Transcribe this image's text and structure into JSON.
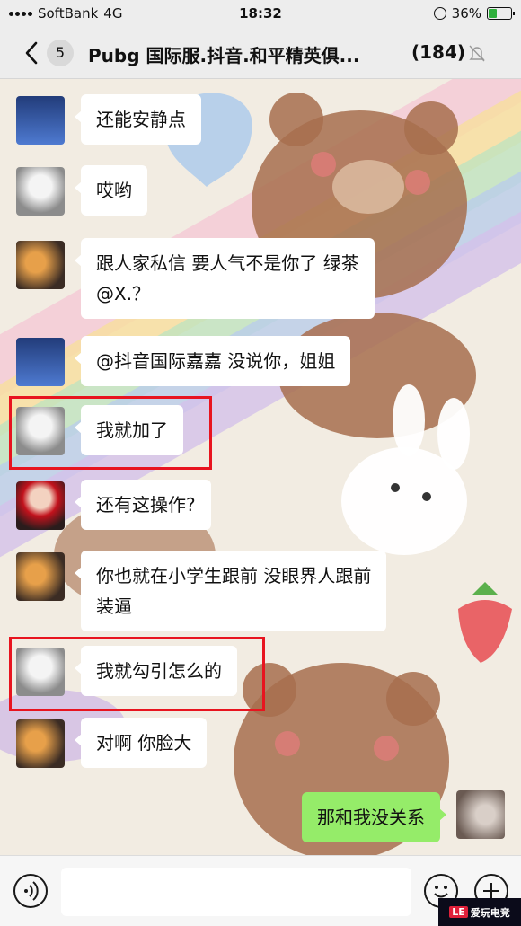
{
  "status_bar": {
    "carrier": "SoftBank",
    "network": "4G",
    "time": "18:32",
    "battery": "36%",
    "battery_level": 0.36
  },
  "header": {
    "unread_count": "5",
    "title": "Pubg 国际服.抖音.和平精英俱...",
    "member_count": "(184)"
  },
  "messages": [
    {
      "sender": "other",
      "avatar": "avatar-game-character",
      "text": "还能安静点"
    },
    {
      "sender": "other",
      "avatar": "avatar-anime-girl",
      "text": "哎哟"
    },
    {
      "sender": "other",
      "avatar": "avatar-photo",
      "text_line1": "跟人家私信 要人气不是你了 绿茶",
      "text_line2": "@X.？"
    },
    {
      "sender": "other",
      "avatar": "avatar-game-character",
      "text": "@抖音国际嘉嘉 没说你，姐姐"
    },
    {
      "sender": "other",
      "avatar": "avatar-anime-girl",
      "text": "我就加了",
      "highlighted": true
    },
    {
      "sender": "other",
      "avatar": "avatar-red-hat-girl",
      "text": "还有这操作?"
    },
    {
      "sender": "other",
      "avatar": "avatar-photo",
      "text_line1": "你也就在小学生跟前 没眼界人跟前",
      "text_line2": "装逼"
    },
    {
      "sender": "other",
      "avatar": "avatar-anime-girl",
      "text": "我就勾引怎么的",
      "highlighted": true
    },
    {
      "sender": "other",
      "avatar": "avatar-photo",
      "text": "对啊 你脸大"
    },
    {
      "sender": "me",
      "avatar": "avatar-self",
      "text": "那和我没关系"
    }
  ],
  "input_bar": {
    "placeholder": ""
  },
  "watermark": {
    "badge": "LE",
    "text": "爱玩电竞"
  },
  "colors": {
    "highlight": "#e8141f",
    "my_bubble": "#95ec69",
    "other_bubble": "#ffffff",
    "battery": "#2fb03c"
  },
  "icons": {
    "back": "chevron-left-icon",
    "mute": "bell-off-icon",
    "voice": "voice-icon",
    "emoji": "emoji-icon",
    "plus": "plus-icon"
  }
}
